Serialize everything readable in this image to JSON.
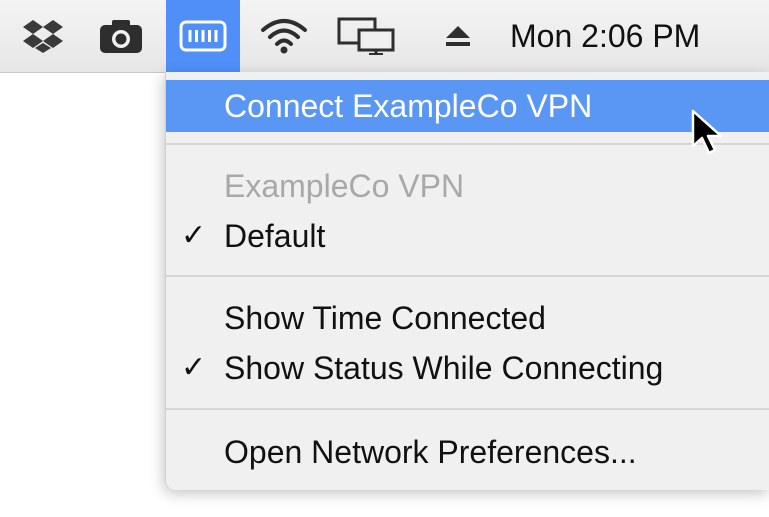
{
  "menubar": {
    "icons": [
      "dropbox-icon",
      "camera-icon",
      "vpn-icon",
      "wifi-icon",
      "display-mirroring-icon",
      "eject-icon"
    ],
    "clock": "Mon 2:06 PM",
    "accent_color": "#4f8ff7"
  },
  "vpn_menu": {
    "connect": "Connect ExampleCo VPN",
    "section_header": "ExampleCo VPN",
    "default": "Default",
    "show_time": "Show Time Connected",
    "show_status": "Show Status While Connecting",
    "open_prefs": "Open Network Preferences...",
    "checkmark": "✓",
    "highlight_color": "#5a97f5"
  }
}
